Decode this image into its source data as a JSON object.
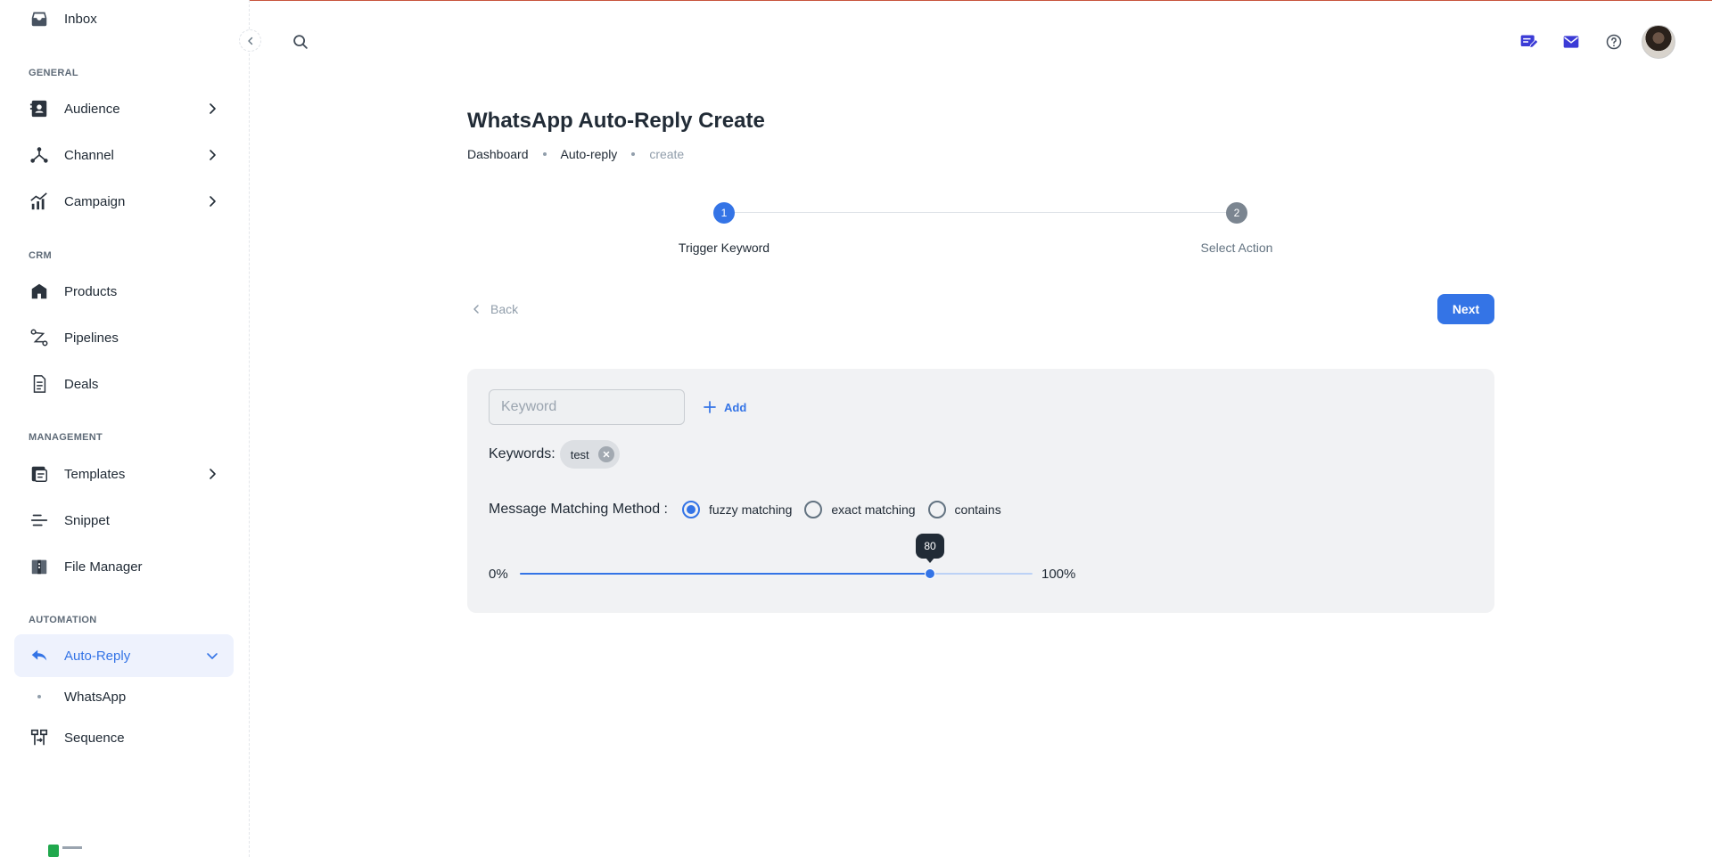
{
  "sidebar": {
    "inbox": "Inbox",
    "sections": {
      "general": "GENERAL",
      "crm": "CRM",
      "management": "MANAGEMENT",
      "automation": "AUTOMATION"
    },
    "items": {
      "audience": "Audience",
      "channel": "Channel",
      "campaign": "Campaign",
      "products": "Products",
      "pipelines": "Pipelines",
      "deals": "Deals",
      "templates": "Templates",
      "snippet": "Snippet",
      "file_manager": "File Manager",
      "auto_reply": "Auto-Reply",
      "whatsapp": "WhatsApp",
      "sequence": "Sequence"
    },
    "active_item": "Auto-Reply"
  },
  "header": {
    "icons": [
      "search-icon",
      "compose-icon",
      "mail-icon",
      "help-icon",
      "avatar"
    ]
  },
  "page": {
    "title": "WhatsApp Auto-Reply Create",
    "breadcrumb": [
      "Dashboard",
      "Auto-reply",
      "create"
    ]
  },
  "stepper": {
    "steps": [
      {
        "number": "1",
        "label": "Trigger Keyword",
        "state": "active"
      },
      {
        "number": "2",
        "label": "Select Action",
        "state": "inactive"
      }
    ]
  },
  "actions": {
    "back_label": "Back",
    "next_label": "Next"
  },
  "form": {
    "keyword_placeholder": "Keyword",
    "keyword_value": "",
    "add_label": "Add",
    "keywords_label": "Keywords:",
    "keywords": [
      "test"
    ],
    "matching_label": "Message Matching Method :",
    "matching_options": [
      {
        "label": "fuzzy matching",
        "checked": true
      },
      {
        "label": "exact matching",
        "checked": false
      },
      {
        "label": "contains",
        "checked": false
      }
    ],
    "slider": {
      "min_label": "0%",
      "max_label": "100%",
      "value": 80,
      "value_label": "80"
    }
  },
  "colors": {
    "primary": "#3474e6",
    "active_bg": "#eef2fd",
    "card_bg": "#f1f2f4",
    "text": "#212b36",
    "muted": "#919eab"
  }
}
